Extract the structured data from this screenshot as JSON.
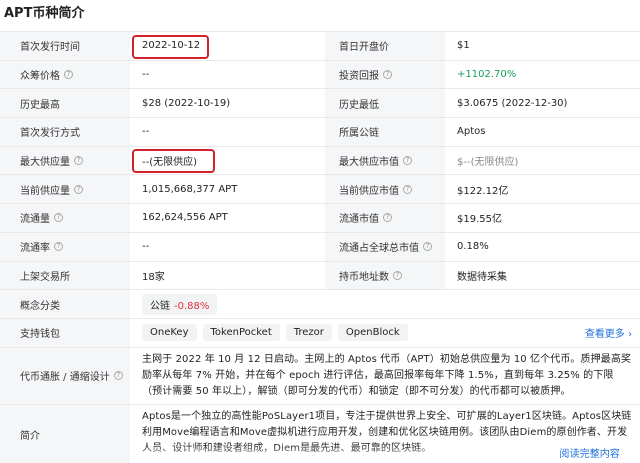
{
  "title": "APT币种简介",
  "rows": [
    {
      "l1": "首次发行时间",
      "v1": "2022-10-12",
      "l2": "首日开盘价",
      "v2": "$1"
    },
    {
      "l1": "众筹价格",
      "v1": "--",
      "l2": "投资回报",
      "v2": "+1102.70%"
    },
    {
      "l1": "历史最高",
      "v1": "$28 (2022-10-19)",
      "l2": "历史最低",
      "v2": "$3.0675 (2022-12-30)"
    },
    {
      "l1": "首次发行方式",
      "v1": "--",
      "l2": "所属公链",
      "v2": "Aptos"
    },
    {
      "l1": "最大供应量",
      "v1": "--(无限供应)",
      "l2": "最大供应市值",
      "v2": "$--(无限供应)"
    },
    {
      "l1": "当前供应量",
      "v1": "1,015,668,377 APT",
      "l2": "当前供应市值",
      "v2": "$122.12亿"
    },
    {
      "l1": "流通量",
      "v1": "162,624,556 APT",
      "l2": "流通市值",
      "v2": "$19.55亿"
    },
    {
      "l1": "流通率",
      "v1": "--",
      "l2": "流通占全球总市值",
      "v2": "0.18%"
    },
    {
      "l1": "上架交易所",
      "v1": "18家",
      "l2": "持币地址数",
      "v2": "数据待采集"
    }
  ],
  "concept": {
    "label": "概念分类",
    "tag": "公链",
    "change": "-0.88%"
  },
  "wallets": {
    "label": "支持钱包",
    "items": [
      "OneKey",
      "TokenPocket",
      "Trezor",
      "OpenBlock"
    ],
    "more": "查看更多 ›"
  },
  "tokenomics": {
    "label": "代币通胀 / 通缩设计",
    "text": "主网于 2022 年 10 月 12 日启动。主网上的 Aptos 代币（APT）初始总供应量为 10 亿个代币。质押最高奖励率从每年 7% 开始，并在每个 epoch 进行评估，最高回报率每年下降 1.5%，直到每年 3.25% 的下限（预计需要 50 年以上），解锁（即可分发的代币）和锁定（即不可分发）的代币都可以被质押。"
  },
  "intro": {
    "label": "简介",
    "text": "Aptos是一个独立的高性能PoSLayer1项目，专注于提供世界上安全、可扩展的Layer1区块链。Aptos区块链利用Move编程语言和Move虚拟机进行应用开发，创建和优化区块链用例。该团队由Diem的原创作者、开发人员、设计师和建设者组成，Diem是最先进、最可靠的区块链。",
    "expand": "阅读完整内容"
  },
  "colors": {
    "green": "#17a05d",
    "red": "#e0313d",
    "link": "#1e6fd9",
    "highlight": "#d2232a"
  }
}
